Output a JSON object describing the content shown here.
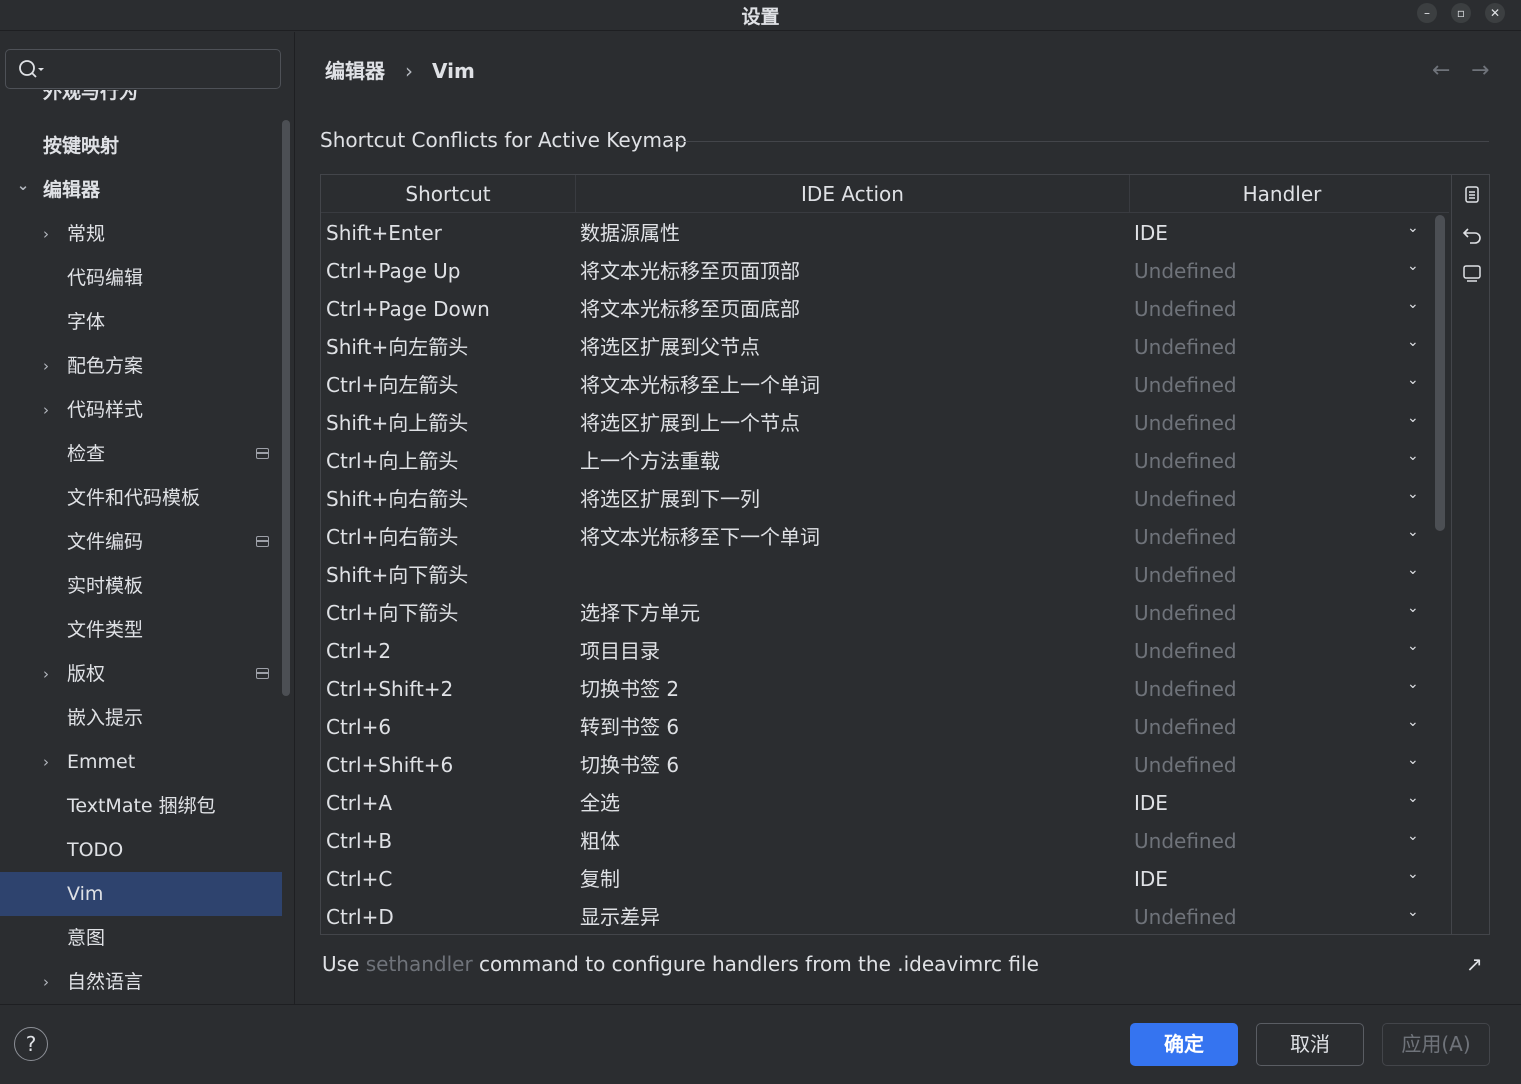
{
  "window": {
    "title": "设置"
  },
  "search": {
    "placeholder": "",
    "value": ""
  },
  "sidebar": {
    "clipped_item": "外观与行为",
    "items": [
      {
        "label": "按键映射",
        "bold": true,
        "chevron": "",
        "project_icon": false
      },
      {
        "label": "编辑器",
        "bold": true,
        "chevron": "expanded",
        "project_icon": false
      },
      {
        "label": "常规",
        "chevron": "collapsed",
        "project_icon": false
      },
      {
        "label": "代码编辑",
        "chevron": "",
        "project_icon": false
      },
      {
        "label": "字体",
        "chevron": "",
        "project_icon": false
      },
      {
        "label": "配色方案",
        "chevron": "collapsed",
        "project_icon": false
      },
      {
        "label": "代码样式",
        "chevron": "collapsed",
        "project_icon": false
      },
      {
        "label": "检查",
        "chevron": "",
        "project_icon": true
      },
      {
        "label": "文件和代码模板",
        "chevron": "",
        "project_icon": false
      },
      {
        "label": "文件编码",
        "chevron": "",
        "project_icon": true
      },
      {
        "label": "实时模板",
        "chevron": "",
        "project_icon": false
      },
      {
        "label": "文件类型",
        "chevron": "",
        "project_icon": false
      },
      {
        "label": "版权",
        "chevron": "collapsed",
        "project_icon": true
      },
      {
        "label": "嵌入提示",
        "chevron": "",
        "project_icon": false
      },
      {
        "label": "Emmet",
        "chevron": "collapsed",
        "project_icon": false
      },
      {
        "label": "TextMate 捆绑包",
        "chevron": "",
        "project_icon": false
      },
      {
        "label": "TODO",
        "chevron": "",
        "project_icon": false
      },
      {
        "label": "Vim",
        "chevron": "",
        "project_icon": false,
        "selected": true
      },
      {
        "label": "意图",
        "chevron": "",
        "project_icon": false
      },
      {
        "label": "自然语言",
        "chevron": "collapsed",
        "project_icon": false
      }
    ]
  },
  "breadcrumb": {
    "parent": "编辑器",
    "separator": "›",
    "current": "Vim"
  },
  "section": {
    "title": "Shortcut Conflicts for Active Keymap"
  },
  "table": {
    "headers": {
      "shortcut": "Shortcut",
      "action": "IDE Action",
      "handler": "Handler"
    },
    "rows": [
      {
        "shortcut": "Shift+Enter",
        "action": "数据源属性",
        "handler": "IDE"
      },
      {
        "shortcut": "Ctrl+Page Up",
        "action": "将文本光标移至页面顶部",
        "handler": "Undefined"
      },
      {
        "shortcut": "Ctrl+Page Down",
        "action": "将文本光标移至页面底部",
        "handler": "Undefined"
      },
      {
        "shortcut": "Shift+向左箭头",
        "action": "将选区扩展到父节点",
        "handler": "Undefined"
      },
      {
        "shortcut": "Ctrl+向左箭头",
        "action": "将文本光标移至上一个单词",
        "handler": "Undefined"
      },
      {
        "shortcut": "Shift+向上箭头",
        "action": "将选区扩展到上一个节点",
        "handler": "Undefined"
      },
      {
        "shortcut": "Ctrl+向上箭头",
        "action": "上一个方法重载",
        "handler": "Undefined"
      },
      {
        "shortcut": "Shift+向右箭头",
        "action": "将选区扩展到下一列",
        "handler": "Undefined"
      },
      {
        "shortcut": "Ctrl+向右箭头",
        "action": "将文本光标移至下一个单词",
        "handler": "Undefined"
      },
      {
        "shortcut": "Shift+向下箭头",
        "action": "",
        "handler": "Undefined"
      },
      {
        "shortcut": "Ctrl+向下箭头",
        "action": "选择下方单元",
        "handler": "Undefined"
      },
      {
        "shortcut": "Ctrl+2",
        "action": "项目目录",
        "handler": "Undefined"
      },
      {
        "shortcut": "Ctrl+Shift+2",
        "action": "切换书签 2",
        "handler": "Undefined"
      },
      {
        "shortcut": "Ctrl+6",
        "action": "转到书签 6",
        "handler": "Undefined"
      },
      {
        "shortcut": "Ctrl+Shift+6",
        "action": "切换书签 6",
        "handler": "Undefined"
      },
      {
        "shortcut": "Ctrl+A",
        "action": "全选",
        "handler": "IDE"
      },
      {
        "shortcut": "Ctrl+B",
        "action": "粗体",
        "handler": "Undefined"
      },
      {
        "shortcut": "Ctrl+C",
        "action": "复制",
        "handler": "IDE"
      },
      {
        "shortcut": "Ctrl+D",
        "action": "显示差异",
        "handler": "Undefined"
      }
    ]
  },
  "footer_note": {
    "prefix": "Use ",
    "link": "sethandler",
    "suffix": " command to configure handlers from the .ideavimrc file"
  },
  "buttons": {
    "ok": "确定",
    "cancel": "取消",
    "apply": "应用(A)"
  },
  "help": {
    "label": "?"
  },
  "colors": {
    "accent": "#3574f0",
    "selection": "#2e436e",
    "background": "#2b2d30",
    "muted": "#6f737a"
  }
}
